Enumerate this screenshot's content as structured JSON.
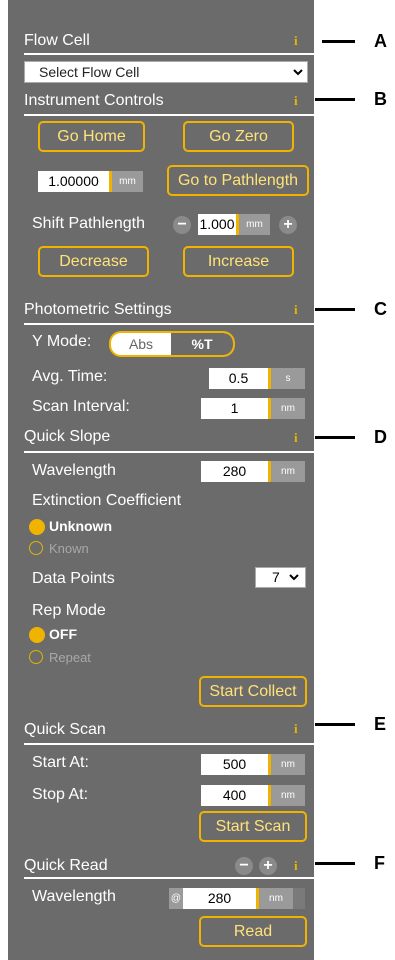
{
  "flow_cell": {
    "title": "Flow Cell",
    "info": "i",
    "select_value": "Select Flow Cell"
  },
  "instrument": {
    "title": "Instrument Controls",
    "info": "i",
    "go_home": "Go Home",
    "go_zero": "Go Zero",
    "path_value": "1.00000",
    "path_unit": "mm",
    "go_pathlength": "Go to Pathlength",
    "shift_label": "Shift Pathlength",
    "shift_minus": "−",
    "shift_value": "1.000",
    "shift_unit": "mm",
    "shift_plus": "+",
    "decrease": "Decrease",
    "increase": "Increase"
  },
  "photometric": {
    "title": "Photometric Settings",
    "info": "i",
    "ymode_label": "Y Mode:",
    "ymode_abs": "Abs",
    "ymode_pt": "%T",
    "avg_label": "Avg. Time:",
    "avg_value": "0.5",
    "avg_unit": "s",
    "scan_label": "Scan Interval:",
    "scan_value": "1",
    "scan_unit": "nm"
  },
  "quick_slope": {
    "title": "Quick Slope",
    "info": "i",
    "wl_label": "Wavelength",
    "wl_value": "280",
    "wl_unit": "nm",
    "ext_label": "Extinction Coefficient",
    "ext_unknown": "Unknown",
    "ext_known": "Known",
    "dp_label": "Data Points",
    "dp_value": "7",
    "rep_label": "Rep Mode",
    "rep_off": "OFF",
    "rep_repeat": "Repeat",
    "start_collect": "Start Collect"
  },
  "quick_scan": {
    "title": "Quick Scan",
    "info": "i",
    "start_label": "Start At:",
    "start_value": "500",
    "start_unit": "nm",
    "stop_label": "Stop At:",
    "stop_value": "400",
    "stop_unit": "nm",
    "start_scan": "Start Scan"
  },
  "quick_read": {
    "title": "Quick Read",
    "info": "i",
    "minus": "−",
    "plus": "+",
    "wl_label": "Wavelength",
    "at": "@",
    "wl_value": "280",
    "wl_unit": "nm",
    "read": "Read"
  },
  "callouts": [
    "A",
    "B",
    "C",
    "D",
    "E",
    "F"
  ],
  "colors": {
    "panel": "#6b6b6b",
    "accent": "#f0b400",
    "button_text": "#ffe27a"
  }
}
